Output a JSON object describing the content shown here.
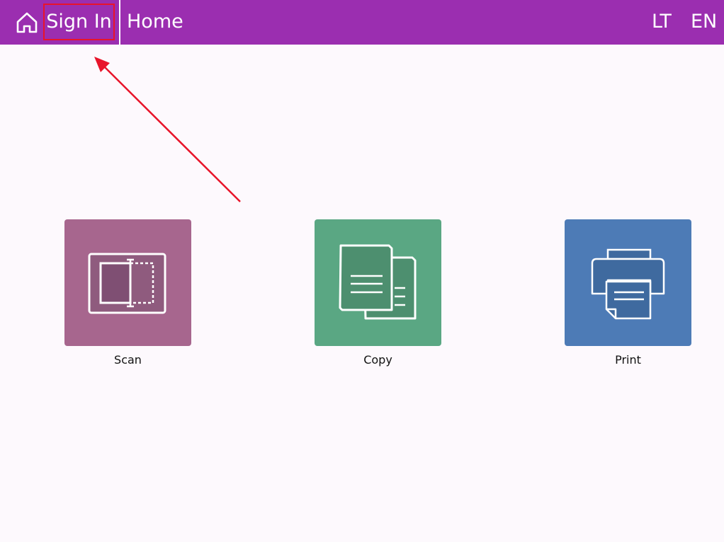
{
  "header": {
    "home_icon": "home-icon",
    "sign_in_label": "Sign In",
    "title": "Home",
    "languages": [
      "LT",
      "EN"
    ],
    "background_color": "#9b2eb0",
    "highlight_color": "#e8142a"
  },
  "tiles": [
    {
      "label": "Scan",
      "icon": "scan-icon",
      "color": "#a7668e"
    },
    {
      "label": "Copy",
      "icon": "copy-icon",
      "color": "#5aa783"
    },
    {
      "label": "Print",
      "icon": "print-icon",
      "color": "#4d7bb6"
    }
  ],
  "annotation": {
    "type": "arrow",
    "target": "Sign In",
    "color": "#e8142a"
  }
}
